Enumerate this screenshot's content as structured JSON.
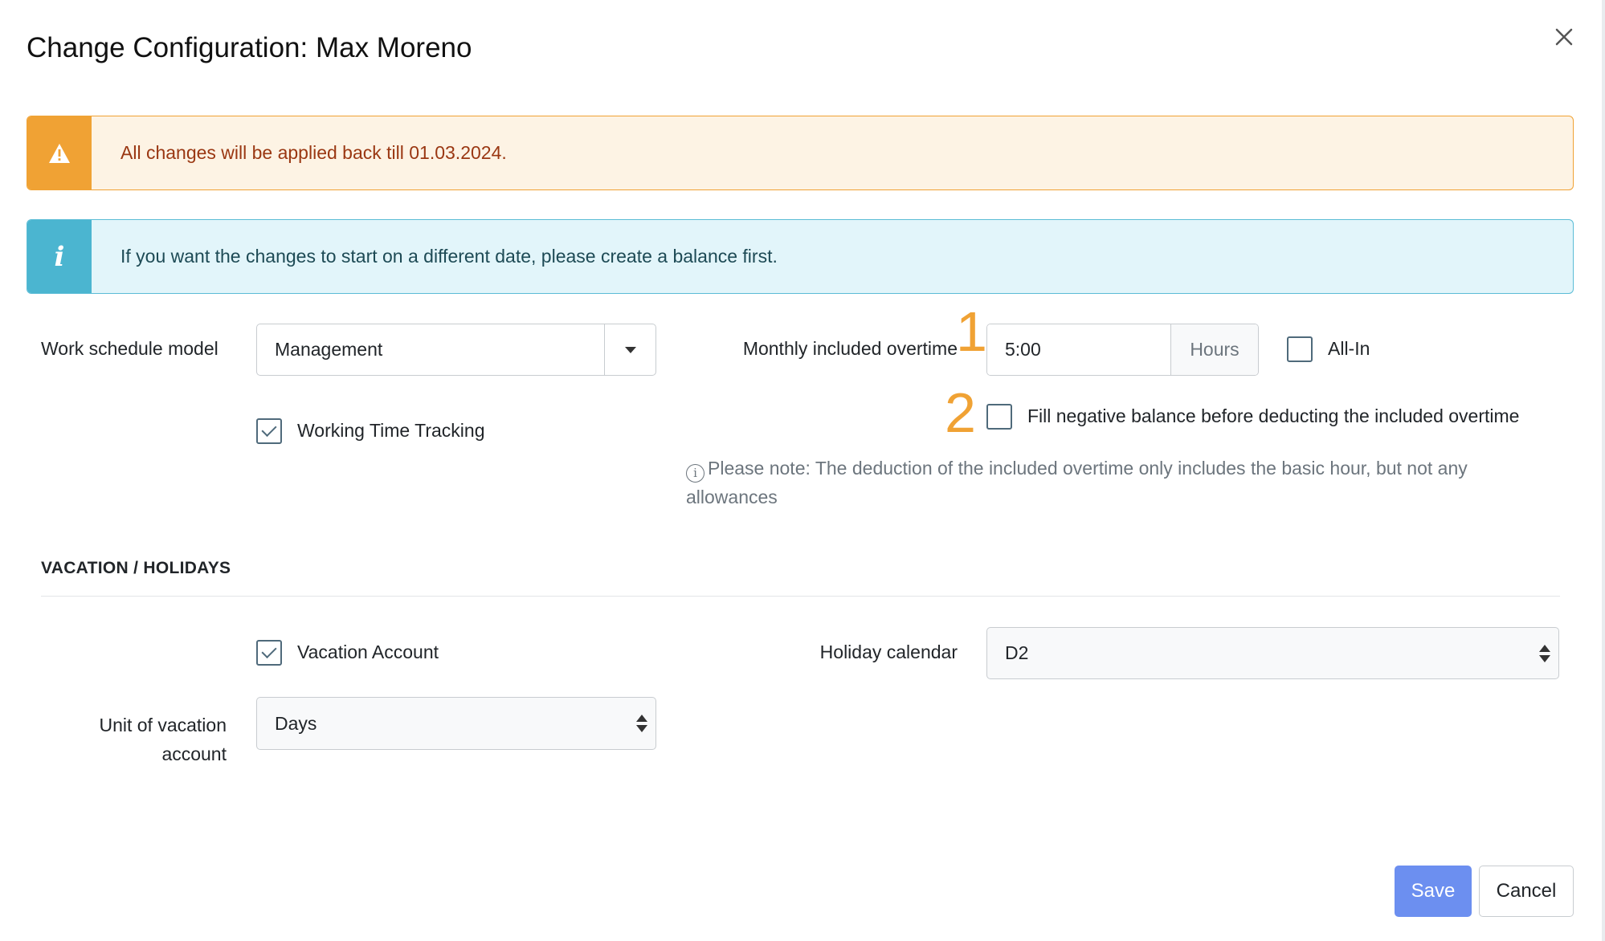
{
  "modal": {
    "title": "Change Configuration: Max Moreno"
  },
  "alerts": {
    "warning": {
      "text": "All changes will be applied back till 01.03.2024.",
      "icon": "warning-triangle-icon"
    },
    "info": {
      "text": "If you want the changes to start on a different date, please create a balance first.",
      "icon": "info-icon",
      "glyph": "i"
    }
  },
  "work": {
    "schedule_model_label": "Work schedule model",
    "schedule_model_value": "Management",
    "working_time_tracking_label": "Working Time Tracking",
    "working_time_tracking_checked": true,
    "monthly_overtime_label": "Monthly included overtime",
    "monthly_overtime_value": "5:00",
    "monthly_overtime_unit": "Hours",
    "all_in_label": "All-In",
    "all_in_checked": false,
    "fill_negative_label": "Fill negative balance before deducting the included overtime",
    "fill_negative_checked": false,
    "note_text": "Please note: The deduction of the included overtime only includes the basic hour, but not any allowances",
    "note_icon_glyph": "i"
  },
  "markers": {
    "one": "1",
    "two": "2"
  },
  "vacation": {
    "section_title": "VACATION / HOLIDAYS",
    "vacation_account_label": "Vacation Account",
    "vacation_account_checked": true,
    "holiday_calendar_label": "Holiday calendar",
    "holiday_calendar_value": "D2",
    "unit_label_line1": "Unit of vacation",
    "unit_label_line2": "account",
    "unit_value": "Days"
  },
  "footer": {
    "save_label": "Save",
    "cancel_label": "Cancel"
  },
  "colors": {
    "warning": "#f0a234",
    "info": "#4bb5d0",
    "primary": "#6c8ff0",
    "marker": "#f0a234"
  }
}
